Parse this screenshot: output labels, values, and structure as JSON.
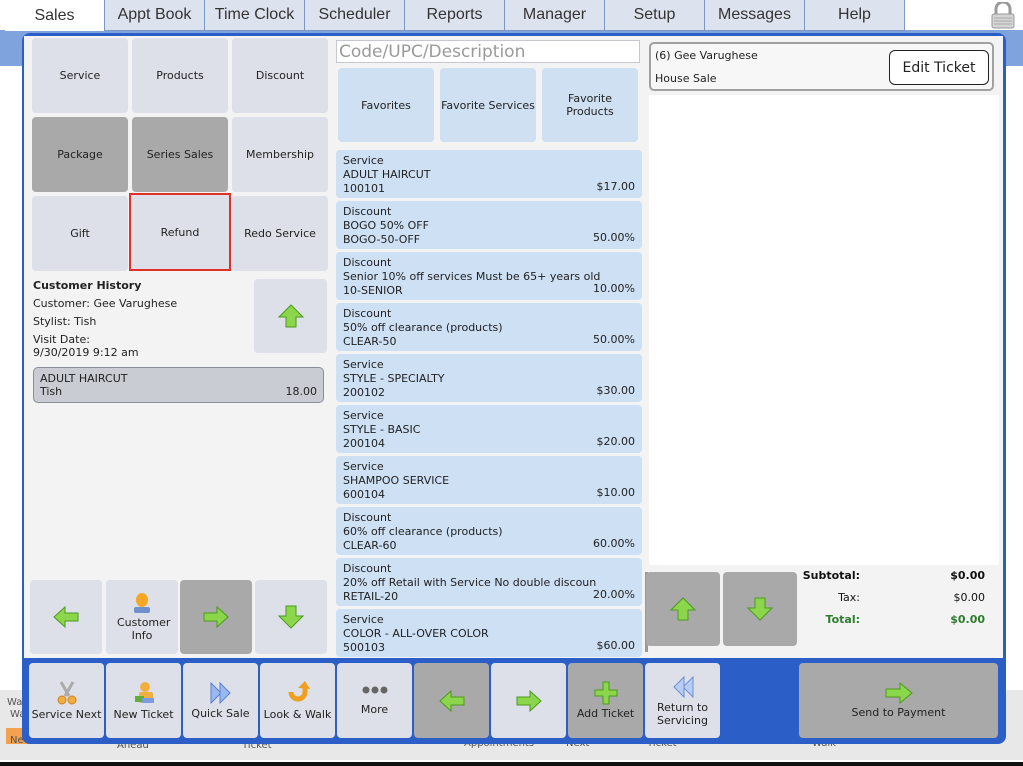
{
  "tabs": [
    {
      "label": "Sales",
      "active": true
    },
    {
      "label": "Appt Book"
    },
    {
      "label": "Time Clock"
    },
    {
      "label": "Scheduler"
    },
    {
      "label": "Reports"
    },
    {
      "label": "Manager"
    },
    {
      "label": "Setup"
    },
    {
      "label": "Messages"
    },
    {
      "label": "Help"
    }
  ],
  "lock_icon": "lock-icon",
  "categories": {
    "service": "Service",
    "products": "Products",
    "discount": "Discount",
    "package": "Package",
    "series_sales": "Series Sales",
    "membership": "Membership",
    "gift": "Gift",
    "refund": "Refund",
    "redo_service": "Redo Service"
  },
  "history": {
    "title": "Customer History",
    "customer": "Customer: Gee Varughese",
    "stylist": "Stylist: Tish",
    "visit_label": "Visit Date:",
    "visit_date": "9/30/2019 9:12 am",
    "item": {
      "name": "ADULT HAIRCUT",
      "stylist": "Tish",
      "amount": "18.00"
    }
  },
  "left_nav": {
    "customer_info": "Customer Info"
  },
  "search": {
    "placeholder": "Code/UPC/Description",
    "value": ""
  },
  "favorites": {
    "favorites": "Favorites",
    "favorite_services": "Favorite Services",
    "favorite_products": "Favorite Products"
  },
  "items": [
    {
      "type": "Service",
      "name": "ADULT HAIRCUT",
      "code": "100101",
      "price": "$17.00"
    },
    {
      "type": "Discount",
      "name": "BOGO 50% OFF",
      "code": "BOGO-50-OFF",
      "price": "50.00%"
    },
    {
      "type": "Discount",
      "name": "Senior 10% off services Must be 65+ years old",
      "code": "10-SENIOR",
      "price": "10.00%"
    },
    {
      "type": "Discount",
      "name": "50% off clearance (products)",
      "code": "CLEAR-50",
      "price": "50.00%"
    },
    {
      "type": "Service",
      "name": "STYLE - SPECIALTY",
      "code": "200102",
      "price": "$30.00"
    },
    {
      "type": "Service",
      "name": "STYLE - BASIC",
      "code": "200104",
      "price": "$20.00"
    },
    {
      "type": "Service",
      "name": "SHAMPOO SERVICE",
      "code": "600104",
      "price": "$10.00"
    },
    {
      "type": "Discount",
      "name": "60% off clearance (products)",
      "code": "CLEAR-60",
      "price": "60.00%"
    },
    {
      "type": "Discount",
      "name": "20% off Retail with Service No double discoun",
      "code": "RETAIL-20",
      "price": "20.00%"
    },
    {
      "type": "Service",
      "name": "COLOR - ALL-OVER COLOR",
      "code": "500103",
      "price": "$60.00"
    }
  ],
  "ticket": {
    "customer": "(6) Gee Varughese",
    "type": "House Sale",
    "edit_label": "Edit Ticket"
  },
  "totals": {
    "subtotal_label": "Subtotal:",
    "subtotal": "$0.00",
    "tax_label": "Tax:",
    "tax": "$0.00",
    "total_label": "Total:",
    "total": "$0.00"
  },
  "bottom": {
    "service_next": "Service Next",
    "new_ticket": "New Ticket",
    "quick_sale": "Quick Sale",
    "look_walk": "Look & Walk",
    "more": "More",
    "add_ticket": "Add Ticket",
    "return_servicing": "Return to Servicing",
    "send_payment": "Send to Payment"
  },
  "background": {
    "texts": [
      "Wa",
      "Wa",
      "Ne",
      "Ahead",
      "Ticket",
      "Appointments",
      "Next",
      "Ticket",
      "Walk"
    ]
  },
  "colors": {
    "window_blue": "#2b5fc7",
    "refund_highlight": "#e0302a",
    "total_green": "#2d7d2d",
    "item_blue": "#cde0f4"
  }
}
